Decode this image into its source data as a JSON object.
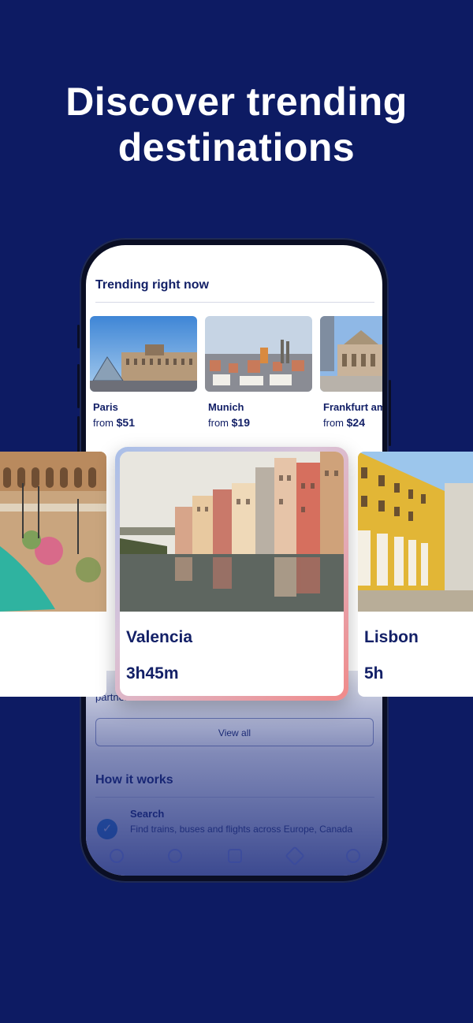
{
  "headline": "Discover trending destinations",
  "trending": {
    "title": "Trending right now",
    "cards": [
      {
        "city": "Paris",
        "price_prefix": "from",
        "price": "$51"
      },
      {
        "city": "Munich",
        "price_prefix": "from",
        "price": "$19"
      },
      {
        "city": "Frankfurt am",
        "price_prefix": "from",
        "price": "$24"
      }
    ]
  },
  "featured": [
    {
      "name": "",
      "duration": ""
    },
    {
      "name": "Valencia",
      "duration": "3h45m"
    },
    {
      "name": "Lisbon",
      "duration": "5h"
    }
  ],
  "partner_text": "partner",
  "view_all_label": "View all",
  "how_it_works": {
    "title": "How it works",
    "step": {
      "title": "Search",
      "description": "Find trains, buses and flights across Europe, Canada"
    }
  },
  "colors": {
    "background": "#0d1b63",
    "accent_blue": "#2e8ad6",
    "text_navy": "#132067"
  },
  "nav_icons": [
    "search-icon",
    "explore-icon",
    "heart-icon",
    "ticket-icon",
    "profile-icon"
  ]
}
